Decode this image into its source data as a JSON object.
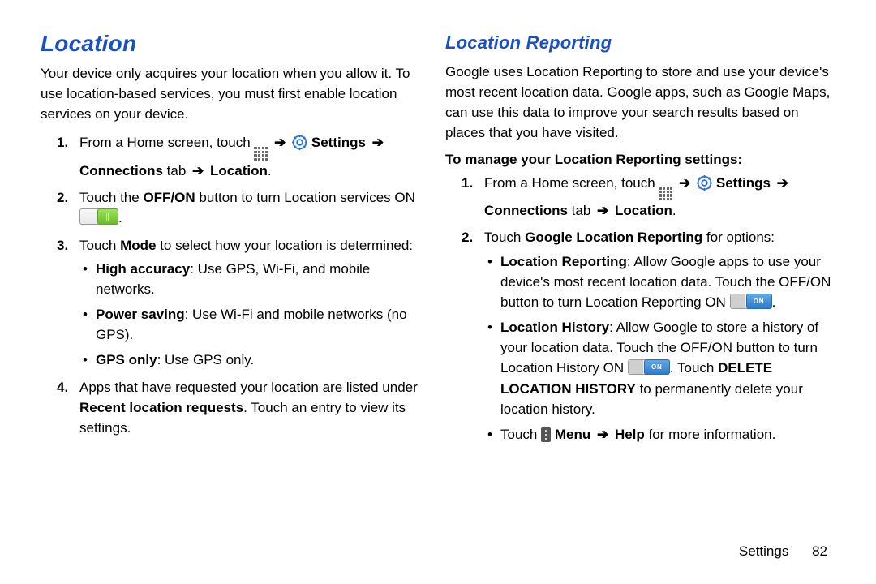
{
  "left": {
    "heading": "Location",
    "intro": "Your device only acquires your location when you allow it. To use location-based services, you must first enable location services on your device.",
    "steps": {
      "s1_a": "From a Home screen, touch",
      "settings": "Settings",
      "connections": "Connections",
      "tab": " tab ",
      "location": "Location",
      "s2_a": "Touch the ",
      "offon": "OFF/ON",
      "s2_b": " button to turn Location services ON ",
      "s3_a": "Touch ",
      "mode": "Mode",
      "s3_b": " to select how your location is determined:",
      "b1_a": "High accuracy",
      "b1_b": ": Use GPS, Wi-Fi, and mobile networks.",
      "b2_a": "Power saving",
      "b2_b": ": Use Wi-Fi and mobile networks (no GPS).",
      "b3_a": "GPS only",
      "b3_b": ": Use GPS only.",
      "s4_a": "Apps that have requested your location are listed under ",
      "recent": "Recent location requests",
      "s4_b": ". Touch an entry to view its settings."
    }
  },
  "right": {
    "heading": "Location Reporting",
    "intro": "Google uses Location Reporting to store and use your device's most recent location data. Google apps, such as Google Maps, can use this data to improve your search results based on places that you have visited.",
    "sub": "To manage your Location Reporting settings:",
    "steps": {
      "s1_a": "From a Home screen, touch",
      "settings": "Settings",
      "connections": "Connections",
      "tab": " tab ",
      "location": "Location",
      "s2_a": "Touch ",
      "glr": "Google Location Reporting",
      "s2_b": " for options:",
      "b1_a": "Location Reporting",
      "b1_b": ": Allow Google apps to use your device's most recent location data. Touch the OFF/ON button to turn Location Reporting ON ",
      "b2_a": "Location History",
      "b2_b": ": Allow Google to store a history of your location data. Touch the OFF/ON button to turn Location History ON ",
      "touch_delete_a": ". Touch ",
      "delete_hist": "DELETE LOCATION HISTORY",
      "delete_hist_b": " to permanently delete your location history.",
      "b3_a": "Touch ",
      "menu": "Menu",
      "help": "Help",
      "b3_b": " for more information."
    }
  },
  "toggle_on_label": "ON",
  "arrow": "➔",
  "footer": {
    "section": "Settings",
    "page": "82"
  }
}
